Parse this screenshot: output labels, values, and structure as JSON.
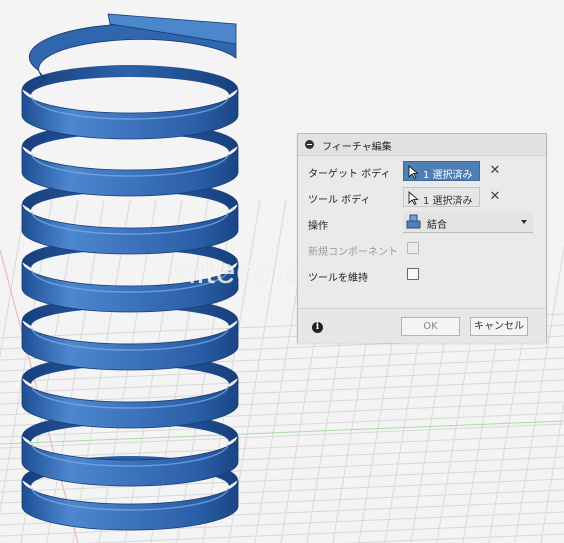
{
  "watermark": "niteco.co.jp",
  "dialog": {
    "title": "フィーチャ編集",
    "rows": {
      "target_body": {
        "label": "ターゲット ボディ",
        "value": "1 選択済み",
        "active": true
      },
      "tool_body": {
        "label": "ツール ボディ",
        "value": "1 選択済み",
        "active": false
      },
      "operation": {
        "label": "操作",
        "value": "結合"
      },
      "new_component": {
        "label": "新規コンポーネント",
        "checked": false,
        "disabled": true
      },
      "keep_tools": {
        "label": "ツールを維持",
        "checked": false,
        "disabled": false
      }
    },
    "buttons": {
      "ok": "OK",
      "cancel": "キャンセル"
    }
  },
  "colors": {
    "spring_blue": "#3f72b5",
    "selection_blue": "#4f7fb4",
    "grid_line": "#d8d8d8",
    "axis_red": "#e8a9a9",
    "axis_green": "#9fd49f"
  },
  "icons": {
    "collapse": "collapse-icon",
    "select_arrow": "select-arrow-icon",
    "clear": "clear-x-icon",
    "combine": "combine-icon",
    "info": "info-icon"
  }
}
